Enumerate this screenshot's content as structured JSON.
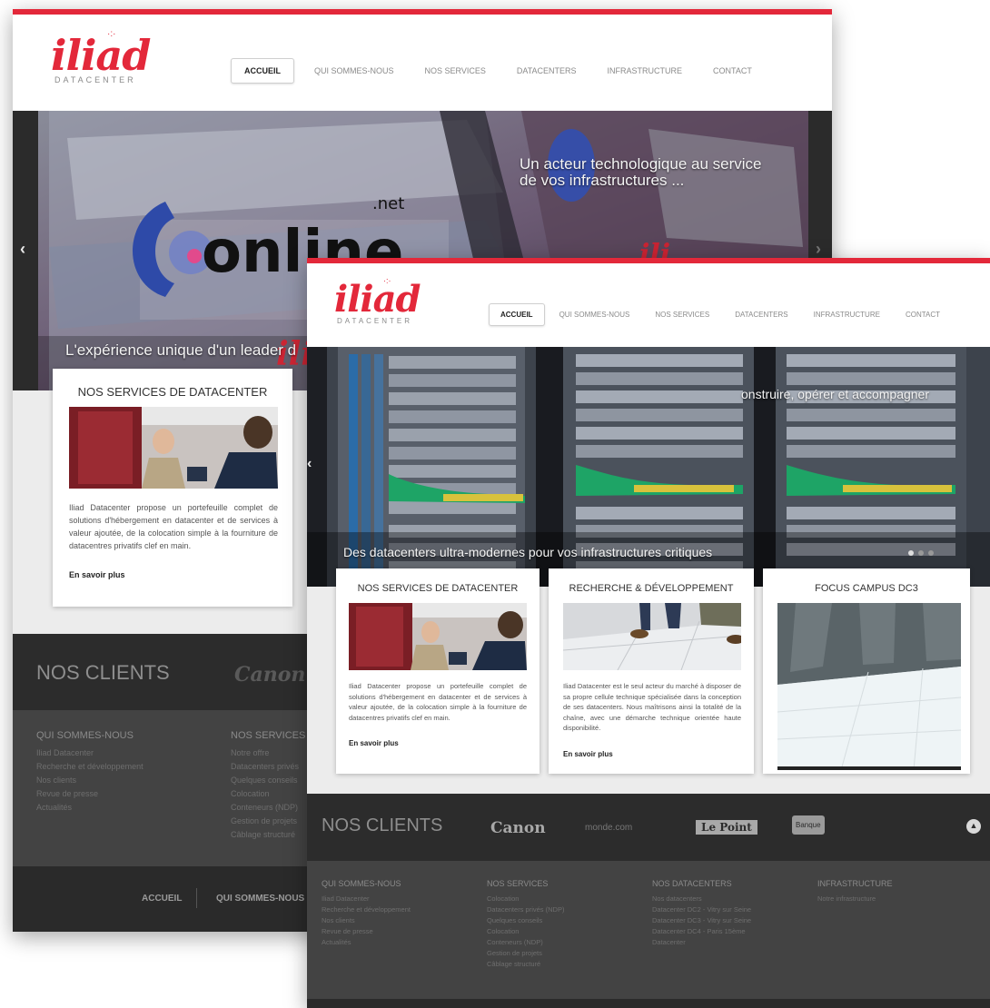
{
  "colors": {
    "accent": "#e3283a",
    "dark_band": "#2c2c2c",
    "footer_bg": "#434343",
    "page_bg": "#ececec"
  },
  "brand": {
    "logo_word": "iliad",
    "logo_sub": "DATACENTER"
  },
  "icons": {
    "mail": "envelope-icon",
    "prev": "chevron-left-icon",
    "next": "chevron-right-icon",
    "back_to_top": "arrow-up-circle-icon"
  },
  "back_mock": {
    "nav": [
      "ACCUEIL",
      "QUI SOMMES-NOUS",
      "NOS SERVICES",
      "DATACENTERS",
      "INFRASTRUCTURE",
      "CONTACT"
    ],
    "slide": {
      "logo_word": "online",
      "logo_suffix": ".net",
      "caption_right": "Un acteur technologique au service\nde vos infrastructures ...",
      "caption_bottom": "L'expérience unique d'un leader d"
    },
    "card": {
      "title": "NOS SERVICES DE DATACENTER",
      "text": "Iliad Datacenter propose un portefeuille complet de solutions d'hébergement en datacenter et de services à valeur ajoutée, de la colocation simple à la fourniture de datacentres privatifs clef en main.",
      "more": "En savoir plus"
    },
    "clients_label": "NOS CLIENTS",
    "client_brand": "Canon",
    "footer": [
      {
        "heading": "QUI SOMMES-NOUS",
        "links": [
          "Iliad Datacenter",
          "Recherche et développement",
          "Nos clients",
          "Revue de presse",
          "Actualités"
        ]
      },
      {
        "heading": "NOS SERVICES",
        "links": [
          "Notre offre",
          "Datacenters privés",
          "Quelques conseils",
          "Colocation",
          "Conteneurs (NDP)",
          "Gestion de projets",
          "Câblage structuré"
        ]
      }
    ],
    "bottom_links": [
      "ACCUEIL",
      "QUI SOMMES-NOUS"
    ]
  },
  "front_mock": {
    "nav": [
      "ACCUEIL",
      "QUI SOMMES-NOUS",
      "NOS SERVICES",
      "DATACENTERS",
      "INFRASTRUCTURE",
      "CONTACT"
    ],
    "slide": {
      "caption_right": "onstruire, opérer et accompagner",
      "caption_bottom": "Des datacenters ultra-modernes pour vos infrastructures critiques"
    },
    "cards": [
      {
        "title": "NOS SERVICES DE DATACENTER",
        "text": "Iliad Datacenter propose un portefeuille complet de solutions d'hébergement en datacenter et de services à valeur ajoutée, de la colocation simple à la fourniture de datacentres privatifs clef en main.",
        "more": "En savoir plus"
      },
      {
        "title": "RECHERCHE & DÉVELOPPEMENT",
        "text": "Iliad Datacenter est le seul acteur du marché à disposer de sa propre cellule technique spécialisée dans la conception de ses datacenters. Nous maîtrisons ainsi la totalité de la chaîne, avec une démarche technique orientée haute disponibilité.",
        "more": "En savoir plus"
      },
      {
        "title": "FOCUS CAMPUS DC3",
        "text": "",
        "more": ""
      }
    ],
    "clients_label": "NOS CLIENTS",
    "client_brands": [
      "Canon",
      "monde.com",
      "Le Point",
      "Banque"
    ],
    "footer": [
      {
        "heading": "QUI SOMMES-NOUS",
        "links": [
          "Iliad Datacenter",
          "Recherche et développement",
          "Nos clients",
          "Revue de presse",
          "Actualités"
        ]
      },
      {
        "heading": "NOS SERVICES",
        "links": [
          "Colocation",
          "Datacenters privés (NDP)",
          "Quelques conseils",
          "Colocation",
          "Conteneurs (NDP)",
          "Gestion de projets",
          "Câblage structuré"
        ]
      },
      {
        "heading": "NOS DATACENTERS",
        "links": [
          "Nos datacenters",
          "Datacenter DC2 - Vitry sur Seine",
          "Datacenter DC3 - Vitry sur Seine",
          "Datacenter DC4 - Paris 15ème",
          "Datacenter"
        ]
      },
      {
        "heading": "INFRASTRUCTURE",
        "links": [
          "Notre infrastructure"
        ]
      }
    ]
  }
}
